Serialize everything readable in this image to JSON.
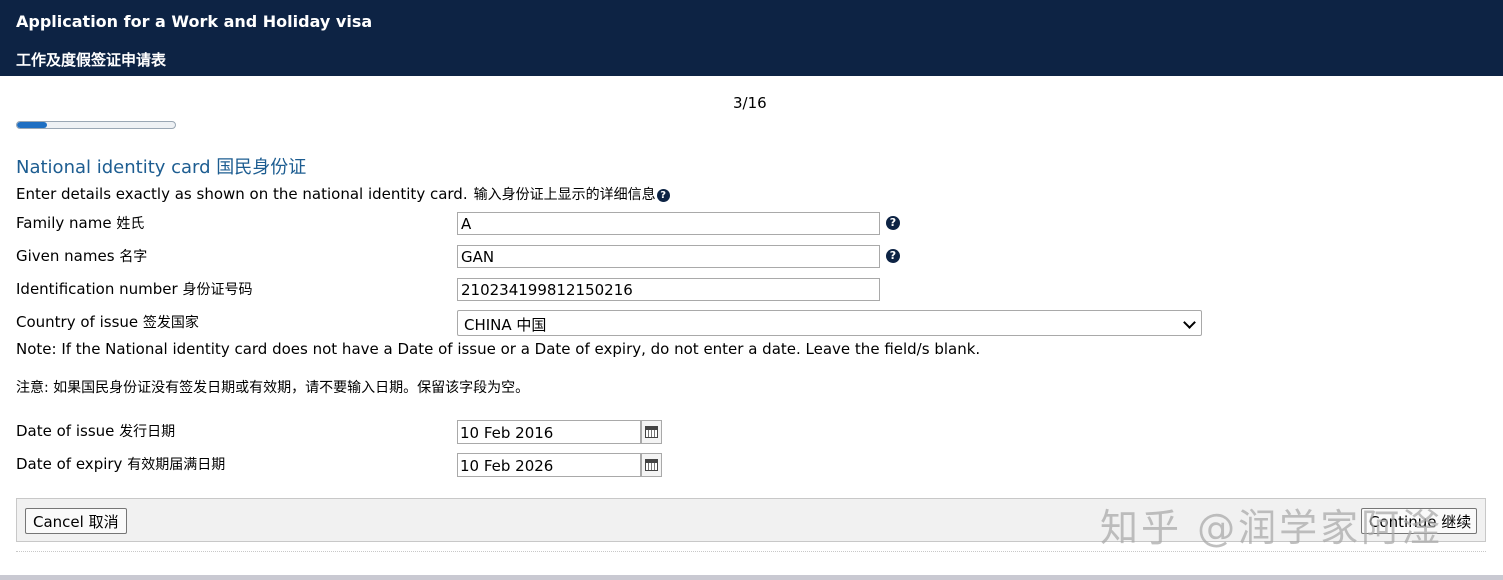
{
  "header": {
    "title_en": "Application for a Work and Holiday visa",
    "title_zh": "工作及度假签证申请表"
  },
  "progress": {
    "step_text": "3/16",
    "current": 3,
    "total": 16,
    "fraction": 0.1875
  },
  "section": {
    "title": "National identity card 国民身份证",
    "intro_en": "Enter details exactly as shown on the national identity card.",
    "intro_zh": "输入身份证上显示的详细信息"
  },
  "fields": {
    "family_name": {
      "label_en": "Family name",
      "label_zh": "姓氏",
      "value": "A"
    },
    "given_names": {
      "label_en": "Given names",
      "label_zh": "名字",
      "value": "GAN"
    },
    "id_number": {
      "label_en": "Identification number",
      "label_zh": "身份证号码",
      "value": "210234199812150216"
    },
    "country_of_issue": {
      "label_en": "Country of issue",
      "label_zh": "签发国家",
      "value": "CHINA 中国"
    },
    "date_of_issue": {
      "label_en": "Date of issue",
      "label_zh": "发行日期",
      "value": "10 Feb 2016"
    },
    "date_of_expiry": {
      "label_en": "Date of expiry",
      "label_zh": "有效期届满日期",
      "value": "10 Feb 2026"
    }
  },
  "notes": {
    "note_en": "Note: If the National identity card does not have a Date of issue or a Date of expiry, do not enter a date. Leave the field/s blank.",
    "note_zh": "注意: 如果国民身份证没有签发日期或有效期，请不要输入日期。保留该字段为空。"
  },
  "buttons": {
    "cancel": "Cancel 取消",
    "continue": "Continue 继续"
  },
  "watermark": "知乎 @润学家阿滏",
  "icons": {
    "help": "question-circle-icon",
    "calendar": "calendar-icon"
  },
  "colors": {
    "header_bg": "#0d2344",
    "accent": "#1f6fc2",
    "section_title": "#1d5d91"
  }
}
